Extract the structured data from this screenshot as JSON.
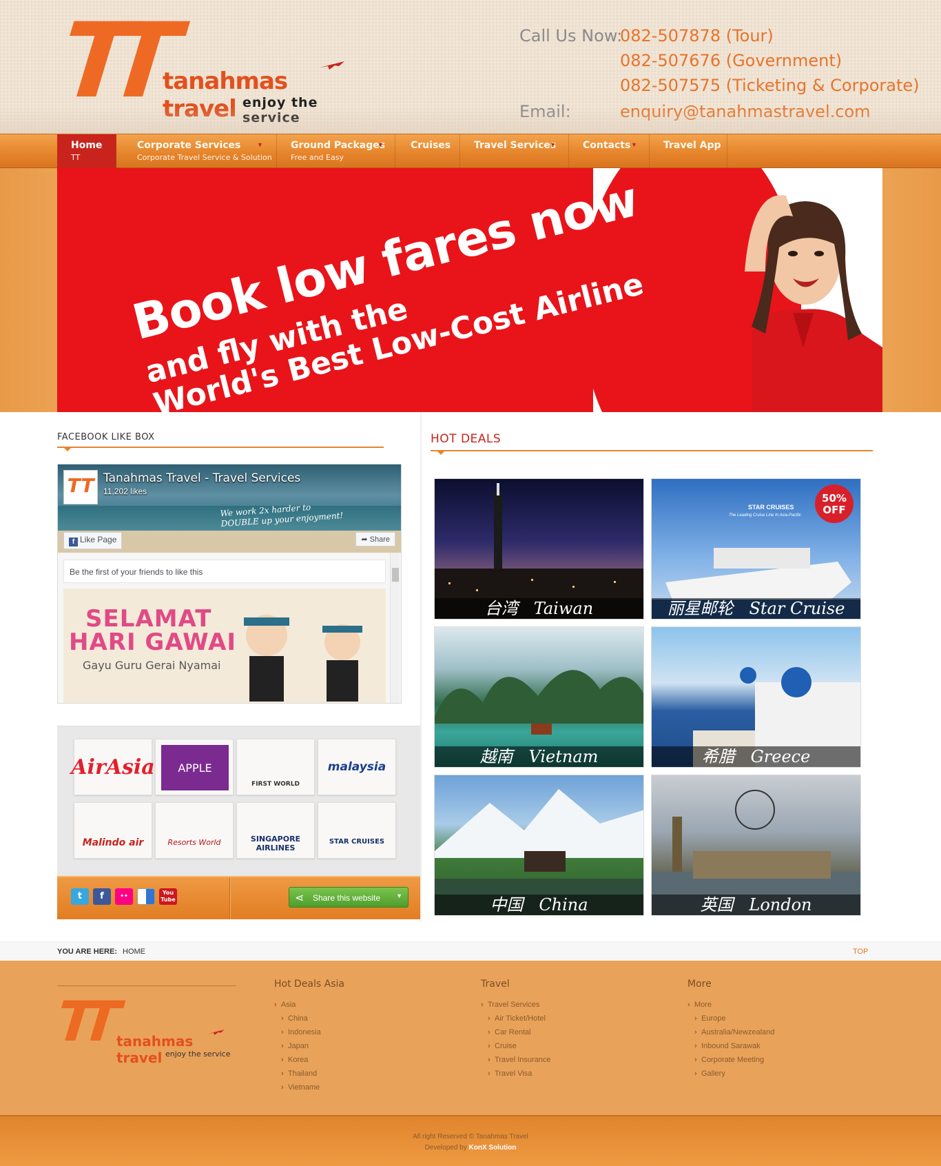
{
  "header": {
    "logo_letters": "TT",
    "brand": "tanahmas travel",
    "tagline": "enjoy the service",
    "call_label": "Call Us Now:",
    "phones": [
      "082-507878 (Tour)",
      "082-507676 (Government)",
      "082-507575 (Ticketing & Corporate)"
    ],
    "email_label": "Email:",
    "email": "enquiry@tanahmastravel.com"
  },
  "nav": [
    {
      "label": "Home",
      "sub": "TT",
      "active": true
    },
    {
      "label": "Corporate Services",
      "sub": "Corporate Travel Service & Solution"
    },
    {
      "label": "Ground Packages",
      "sub": "Free and Easy"
    },
    {
      "label": "Cruises",
      "sub": ""
    },
    {
      "label": "Travel Services",
      "sub": ""
    },
    {
      "label": "Contacts",
      "sub": ""
    },
    {
      "label": "Travel App",
      "sub": ""
    }
  ],
  "banner": {
    "line1": "Book low fares now",
    "line2": "and fly with the",
    "line3": "World's Best Low-Cost Airline"
  },
  "facebook": {
    "heading": "FACEBOOK LIKE BOX",
    "page_name": "Tanahmas Travel - Travel Services",
    "likes": "11,202 likes",
    "slogan1": "We work 2x harder to",
    "slogan2": "DOUBLE up your enjoyment!",
    "like_btn": "Like Page",
    "share_btn": "Share",
    "friends_text": "Be the first of your friends to like this",
    "post_line1": "SELAMAT",
    "post_line2": "HARI GAWAI",
    "post_line3": "Gayu Guru Gerai Nyamai"
  },
  "partners": [
    {
      "name": "AirAsia",
      "label": "AirAsia"
    },
    {
      "name": "Apple",
      "label": "APPLE"
    },
    {
      "name": "First World",
      "label": "FIRST WORLD"
    },
    {
      "name": "Malaysia Airlines",
      "label": "malaysia"
    },
    {
      "name": "Malindo Air",
      "label": "Malindo air"
    },
    {
      "name": "Resorts World",
      "label": "Resorts World"
    },
    {
      "name": "Singapore Airlines",
      "label": "SINGAPORE AIRLINES"
    },
    {
      "name": "Star Cruises",
      "label": "STAR CRUISES"
    }
  ],
  "social": {
    "icons": [
      "twitter-icon",
      "facebook-icon",
      "flickr-icon",
      "delicious-icon",
      "youtube-icon"
    ],
    "icon_text": [
      "t",
      "f",
      "••",
      "",
      "You Tube"
    ],
    "share_label": "Share this website"
  },
  "hot_deals": {
    "heading": "HOT DEALS",
    "items": [
      {
        "zh": "台湾",
        "en": "Taiwan"
      },
      {
        "zh": "丽星邮轮",
        "en": "Star Cruise",
        "brand": "STAR CRUISES",
        "brand_sub": "The Leading Cruise Line In Asia-Pacific",
        "badge_pct": "50%",
        "badge_off": "OFF"
      },
      {
        "zh": "越南",
        "en": "Vietnam"
      },
      {
        "zh": "希腊",
        "en": "Greece"
      },
      {
        "zh": "中国",
        "en": "China"
      },
      {
        "zh": "英国",
        "en": "London"
      }
    ]
  },
  "breadcrumb": {
    "label": "YOU ARE HERE:",
    "current": "HOME",
    "top": "TOP"
  },
  "footer": {
    "logo_letters": "TT",
    "brand": "tanahmas travel",
    "tagline": "enjoy the service",
    "cols": [
      {
        "title": "Hot Deals Asia",
        "parent": "Asia",
        "items": [
          "China",
          "Indonesia",
          "Japan",
          "Korea",
          "Thailand",
          "Vietname"
        ]
      },
      {
        "title": "Travel",
        "parent": "Travel Services",
        "items": [
          "Air Ticket/Hotel",
          "Car Rental",
          "Cruise",
          "Travel Insurance",
          "Travel Visa"
        ]
      },
      {
        "title": "More",
        "parent": "More",
        "items": [
          "Europe",
          "Australia/Newzealand",
          "Inbound Sarawak",
          "Corporate Meeting",
          "Gallery"
        ]
      }
    ],
    "copyright": "All right Reserved © Tanahmas Travel",
    "developed_prefix": "Developed by",
    "developer": "KonX Solution"
  },
  "colors": {
    "accent": "#e7742c",
    "nav": "#e5832a",
    "banner_red": "#e8141a",
    "footer": "#e9a25a"
  }
}
